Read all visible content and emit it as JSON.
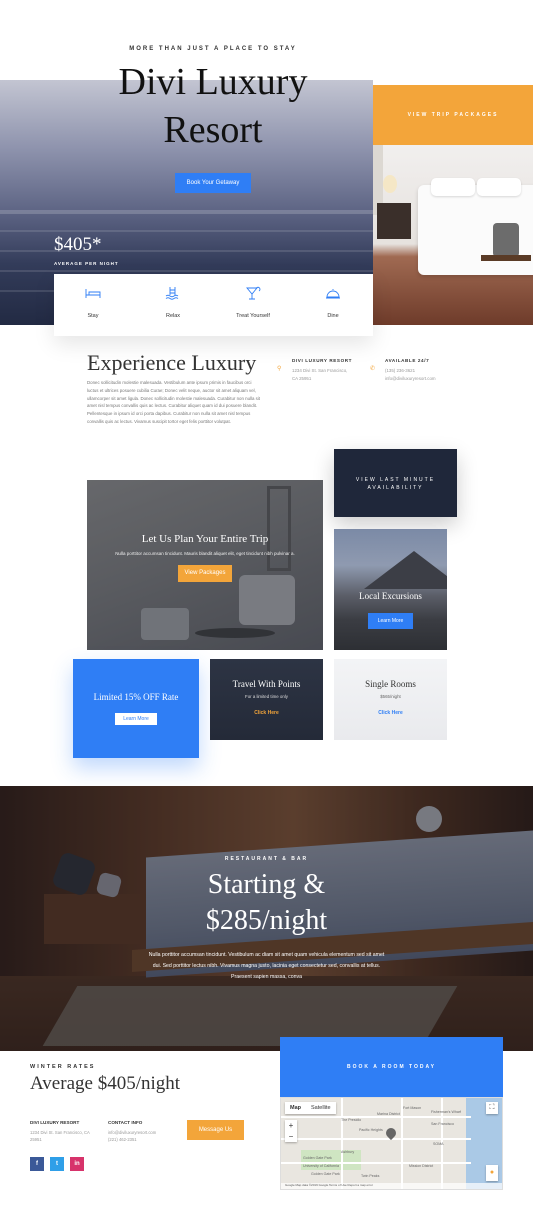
{
  "hero": {
    "tagline": "MORE THAN JUST A PLACE TO STAY",
    "title_line1": "Divi Luxury",
    "title_line2": "Resort",
    "cta": "Book Your Getaway",
    "price": "$405*",
    "price_note": "AVERAGE PER NIGHT",
    "trip_button": "VIEW TRIP PACKAGES"
  },
  "amenities": [
    {
      "label": "Stay",
      "icon": "bed-icon"
    },
    {
      "label": "Relax",
      "icon": "pool-icon"
    },
    {
      "label": "Treat Yourself",
      "icon": "cocktail-icon"
    },
    {
      "label": "Dine",
      "icon": "cloche-icon"
    }
  ],
  "experience": {
    "title": "Experience Luxury",
    "body": "Donec sollicitudin molestie malesuada. Vestibulum ante ipsum primis in faucibus orci luctus et ultrices posuere cubilia Curae; Donec velit neque, auctor sit amet aliquam vel, ullamcorper sit amet ligula. Donec sollicitudin molestie malesuada. Curabitur non nulla sit amet nisl tempus convallis quis ac lectus. Curabitur aliquet quam id dui posuere blandit. Pellentesque in ipsum id orci porta dapibus. Curabitur non nulla sit amet nisl tempus convallis quis ac lectus. Vivamus suscipit tortor eget felis porttitor volutpat.",
    "address_head": "DIVI LUXURY RESORT",
    "address_line1": "1234 Divi St. San Francisco,",
    "address_line2": "CA 25951",
    "hours_head": "AVAILABLE 24/7",
    "phone": "(135) 236-3621",
    "email": "info@diviluxuryresort.com"
  },
  "grid": {
    "last_minute_line1": "VIEW LAST MINUTE",
    "last_minute_line2": "AVAILABILITY",
    "plan_title": "Let Us Plan Your Entire Trip",
    "plan_text": "Nulla porttitor accumsan tincidunt. Mauris blandit aliquet elit, eget tincidunt nibh pulvinar a.",
    "plan_button": "View Packages",
    "excursion_title": "Local Excursions",
    "excursion_button": "Learn More",
    "limited_title": "Limited 15% OFF Rate",
    "limited_button": "Learn More",
    "points_title": "Travel With Points",
    "points_sub": "For a limited time only",
    "points_link": "Click Here",
    "single_title": "Single Rooms",
    "single_sub": "$565/night",
    "single_link": "Click Here"
  },
  "restaurant": {
    "tag": "RESTAURANT & BAR",
    "title_line1": "Starting &",
    "title_line2": "$285/night",
    "body": "Nulla porttitor accumsan tincidunt. Vestibulum ac diam sit amet quam vehicula elementum sed sit amet dui. Sed porttitor lectus nibh. Vivamus magna justo, lacinia eget consectetur sed, convallis at tellus. Praesent sapien massa, conva"
  },
  "footer": {
    "winter": "WINTER RATES",
    "average": "Average $405/night",
    "resort_head": "DIVI LUXURY RESORT",
    "resort_line1": "1234 Divi St. San Francisco, CA",
    "resort_line2": "25951",
    "contact_head": "CONTACT INFO",
    "contact_email": "info@diviluxuryresort.com",
    "contact_phone": "(221) 462-2351",
    "message_button": "Message Us",
    "book_button": "BOOK A ROOM TODAY",
    "social": [
      "f",
      "t",
      "in"
    ]
  },
  "map": {
    "tab_map": "Map",
    "tab_satellite": "Satellite",
    "zoom_in": "+",
    "zoom_out": "−",
    "labels": [
      "Fort Mason",
      "The Presidio",
      "Marina District",
      "Fisherman's Wharf",
      "San Francisco",
      "Pacific Heights",
      "Ashbury",
      "SOMA",
      "Mission District",
      "Golden Gate Park",
      "University of California",
      "Golden Gate Park",
      "Twin Peaks"
    ],
    "attribution": "Google   Map data ©2019 Google   Terms of Use   Report a map error"
  },
  "colors": {
    "accent_blue": "#2f7ef5",
    "accent_gold": "#f3a53a",
    "dark_navy": "#1f273a"
  }
}
